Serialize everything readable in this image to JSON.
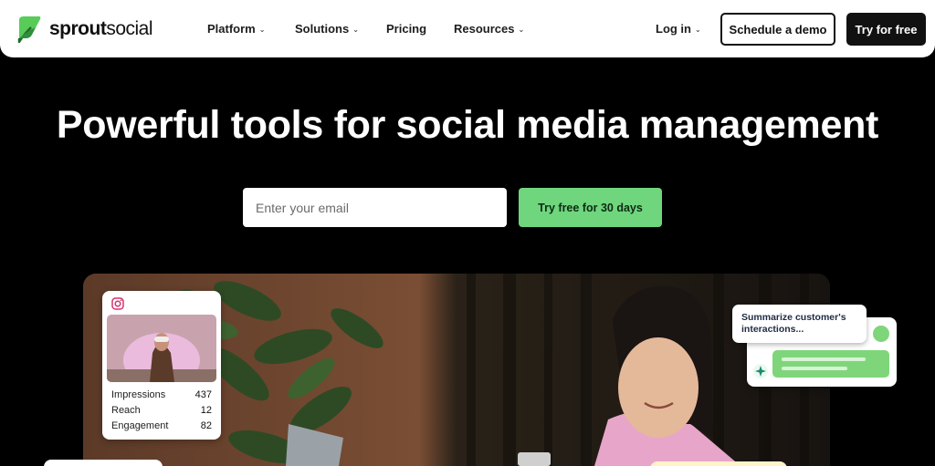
{
  "nav": {
    "brand": {
      "bold": "sprout",
      "regular": "social"
    },
    "items": [
      {
        "label": "Platform",
        "has_menu": true
      },
      {
        "label": "Solutions",
        "has_menu": true
      },
      {
        "label": "Pricing",
        "has_menu": false
      },
      {
        "label": "Resources",
        "has_menu": true
      }
    ],
    "login": "Log in",
    "schedule_demo": "Schedule a demo",
    "try_free": "Try for free"
  },
  "hero": {
    "title": "Powerful tools for social media management",
    "email_placeholder": "Enter your email",
    "cta": "Try free for 30 days"
  },
  "insta_card": {
    "icon": "instagram-icon",
    "stats": [
      {
        "label": "Impressions",
        "value": "437"
      },
      {
        "label": "Reach",
        "value": "12"
      },
      {
        "label": "Engagement",
        "value": "82"
      }
    ]
  },
  "ai_card": {
    "prompt": "Summarize customer's interactions..."
  },
  "colors": {
    "brand_green": "#59cb59",
    "cta_green": "#6fd67e",
    "background": "#000000"
  }
}
